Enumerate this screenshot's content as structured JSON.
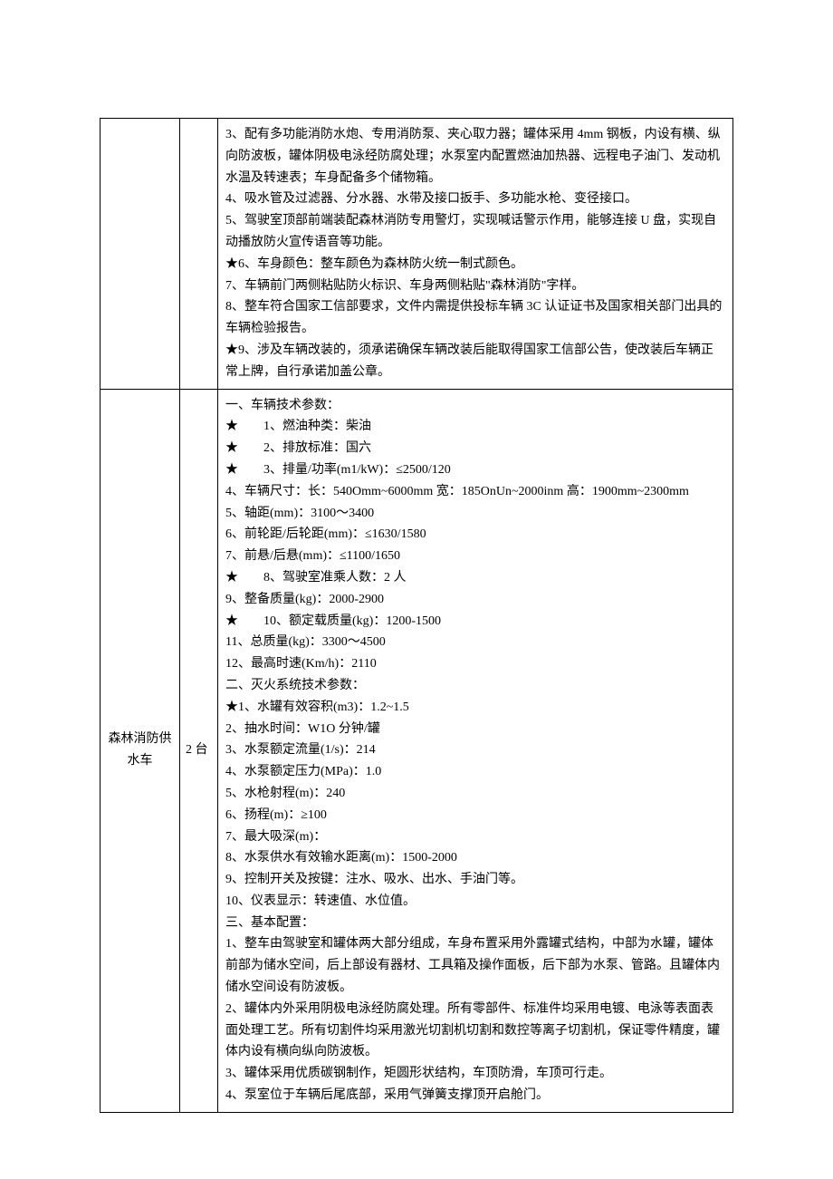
{
  "rows": [
    {
      "name": "",
      "qty": "",
      "specs": [
        "3、配有多功能消防水炮、专用消防泵、夹心取力器；罐体采用 4mm 钢板，内设有横、纵向防波板，罐体阴极电泳经防腐处理；水泵室内配置燃油加热器、远程电子油门、发动机水温及转速表；车身配备多个储物箱。",
        "4、吸水管及过滤器、分水器、水带及接口扳手、多功能水枪、变径接口。",
        "5、驾驶室顶部前端装配森林消防专用警灯，实现喊话警示作用，能够连接 U 盘，实现自动播放防火宣传语音等功能。",
        "★6、车身颜色：整车颜色为森林防火统一制式颜色。",
        "7、车辆前门两侧粘贴防火标识、车身两侧粘贴\"森林消防\"字样。",
        "8、整车符合国家工信部要求，文件内需提供投标车辆 3C 认证证书及国家相关部门出具的车辆检验报告。",
        "★9、涉及车辆改装的，须承诺确保车辆改装后能取得国家工信部公告，使改装后车辆正常上牌，自行承诺加盖公章。"
      ]
    },
    {
      "name": "森林消防供水车",
      "qty": "2 台",
      "specs": [
        "一、车辆技术参数：",
        "★　　1、燃油种类：柴油",
        "★　　2、排放标准：国六",
        "★　　3、排量/功率(m1/kW)：≤2500/120",
        "4、车辆尺寸：长：540Omm~6000mm 宽：185OnUn~2000inm 高：1900mm~2300mm",
        "5、轴距(mm)：3100～3400",
        "6、前轮距/后轮距(mm)：≤1630/1580",
        "7、前悬/后悬(mm)：≤1100/1650",
        "★　　8、驾驶室准乘人数：2 人",
        "9、整备质量(kg)：2000-2900",
        "★　　10、额定载质量(kg)：1200-1500",
        "11、总质量(kg)：3300～4500",
        "12、最高时速(Km/h)：2110",
        "二、灭火系统技术参数：",
        "★1、水罐有效容积(m3)：1.2~1.5",
        "2、抽水时间：W1O 分钟/罐",
        "3、水泵额定流量(1/s)：214",
        "4、水泵额定压力(MPa)：1.0",
        "5、水枪射程(m)：240",
        "6、扬程(m)：≥100",
        "7、最大吸深(m)：",
        "8、水泵供水有效输水距离(m)：1500-2000",
        "9、控制开关及按键：注水、吸水、出水、手油门等。",
        "10、仪表显示：转速值、水位值。",
        "三、基本配置：",
        "1、整车由驾驶室和罐体两大部分组成，车身布置采用外露罐式结构，中部为水罐，罐体前部为储水空间，后上部设有器材、工具箱及操作面板，后下部为水泵、管路。且罐体内储水空间设有防波板。",
        "2、罐体内外采用阴极电泳经防腐处理。所有零部件、标准件均采用电镀、电泳等表面表面处理工艺。所有切割件均采用激光切割机切割和数控等离子切割机，保证零件精度，罐体内设有横向纵向防波板。",
        "3、罐体采用优质碳钢制作，矩圆形状结构，车顶防滑，车顶可行走。",
        "4、泵室位于车辆后尾底部，采用气弹簧支撑顶开启舱门。"
      ]
    }
  ]
}
